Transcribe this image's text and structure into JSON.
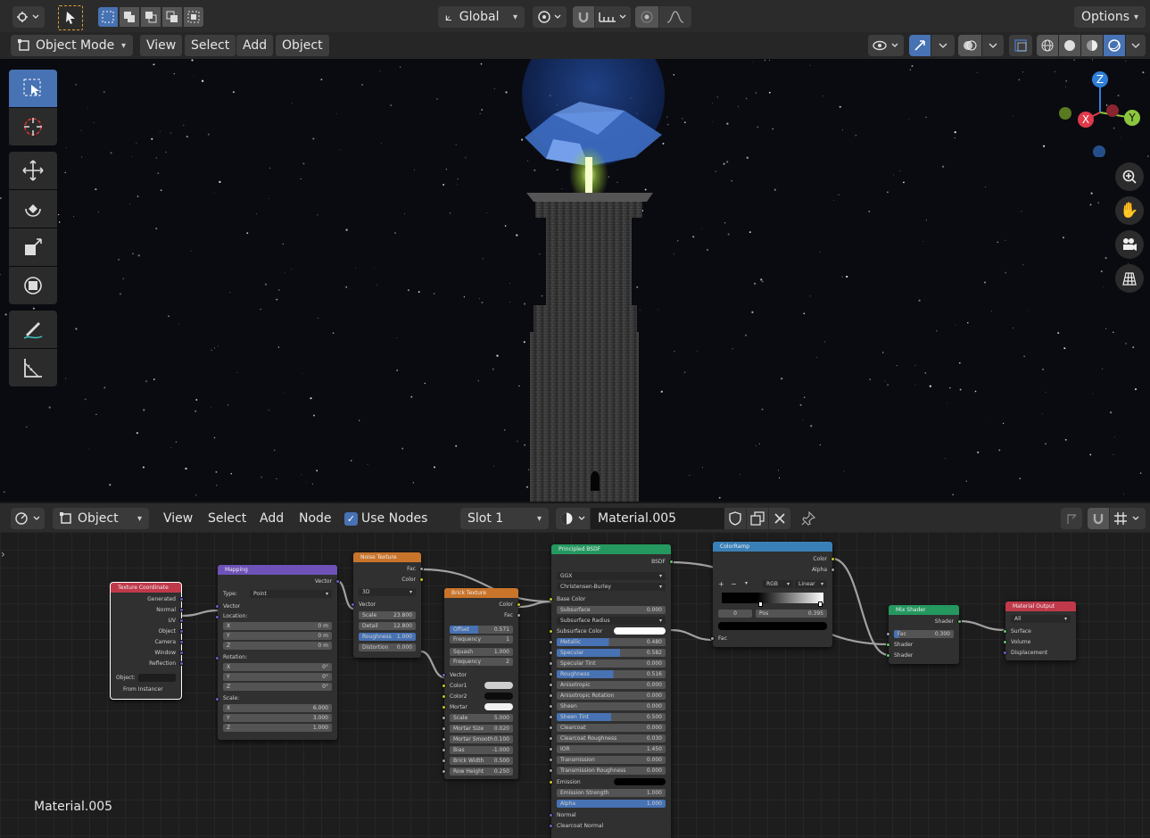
{
  "top_header": {
    "editor_type_icon": "editor-type-icon",
    "select_mode_icons": [
      "select-box-icon",
      "select-extend-icon",
      "select-subtract-icon",
      "select-invert-icon",
      "select-intersect-icon"
    ],
    "transform_orientation": "Global",
    "options_label": "Options"
  },
  "viewport_header": {
    "mode": "Object Mode",
    "menus": [
      "View",
      "Select",
      "Add",
      "Object"
    ]
  },
  "toolbar": {
    "tools": [
      "select-box-icon",
      "cursor-icon",
      "move-icon",
      "rotate-icon",
      "scale-icon",
      "transform-icon",
      "annotate-icon",
      "measure-icon"
    ]
  },
  "gizmo": {
    "x": "X",
    "y": "Y",
    "z": "Z"
  },
  "node_header": {
    "object_dropdown": "Object",
    "menus": [
      "View",
      "Select",
      "Add",
      "Node"
    ],
    "use_nodes_label": "Use Nodes",
    "use_nodes": true,
    "slot": "Slot 1",
    "material_name": "Material.005"
  },
  "material_footer_label": "Material.005",
  "nodes": {
    "texcoord": {
      "title": "Texture Coordinate",
      "outputs": [
        "Generated",
        "Normal",
        "UV",
        "Object",
        "Camera",
        "Window",
        "Reflection"
      ],
      "object_label": "Object:",
      "instancer": "From Instancer"
    },
    "mapping": {
      "title": "Mapping",
      "output": "Vector",
      "type_label": "Type:",
      "type": "Point",
      "input": "Vector",
      "location_label": "Location:",
      "loc": [
        [
          "X",
          "0 m"
        ],
        [
          "Y",
          "0 m"
        ],
        [
          "Z",
          "0 m"
        ]
      ],
      "rotation_label": "Rotation:",
      "rot": [
        [
          "X",
          "0°"
        ],
        [
          "Y",
          "0°"
        ],
        [
          "Z",
          "0°"
        ]
      ],
      "scale_label": "Scale:",
      "scale": [
        [
          "X",
          "6.000"
        ],
        [
          "Y",
          "3.000"
        ],
        [
          "Z",
          "1.000"
        ]
      ]
    },
    "noise": {
      "title": "Noise Texture",
      "outputs": [
        "Fac",
        "Color"
      ],
      "dim": "3D",
      "input": "Vector",
      "fields": [
        [
          "Scale",
          "23.800"
        ],
        [
          "Detail",
          "12.800"
        ],
        [
          "Roughness",
          "1.000"
        ],
        [
          "Distortion",
          "0.000"
        ]
      ]
    },
    "brick": {
      "title": "Brick Texture",
      "outputs": [
        "Color",
        "Fac"
      ],
      "fields1": [
        [
          "Offset",
          "0.571"
        ],
        [
          "Frequency",
          "1"
        ],
        [
          "Squash",
          "1.000"
        ],
        [
          "Frequency",
          "2"
        ]
      ],
      "inputs": [
        "Vector",
        "Color1",
        "Color2",
        "Mortar"
      ],
      "fields2": [
        [
          "Scale",
          "5.000"
        ],
        [
          "Mortar Size",
          "0.020"
        ],
        [
          "Mortar Smooth",
          "0.100"
        ],
        [
          "Bias",
          "-1.000"
        ],
        [
          "Brick Width",
          "0.500"
        ],
        [
          "Row Height",
          "0.250"
        ]
      ]
    },
    "bsdf": {
      "title": "Principled BSDF",
      "output": "BSDF",
      "distribution": "GGX",
      "subsurface_method": "Christensen-Burley",
      "base_color": "Base Color",
      "subsurface": [
        "Subsurface",
        "0.000"
      ],
      "subsurface_radius": "Subsurface Radius",
      "subsurface_color": "Subsurface Color",
      "fields": [
        [
          "Metallic",
          "0.480"
        ],
        [
          "Specular",
          "0.582"
        ],
        [
          "Specular Tint",
          "0.000"
        ],
        [
          "Roughness",
          "0.516"
        ],
        [
          "Anisotropic",
          "0.000"
        ],
        [
          "Anisotropic Rotation",
          "0.000"
        ],
        [
          "Sheen",
          "0.000"
        ],
        [
          "Sheen Tint",
          "0.500"
        ],
        [
          "Clearcoat",
          "0.000"
        ],
        [
          "Clearcoat Roughness",
          "0.030"
        ],
        [
          "IOR",
          "1.450"
        ],
        [
          "Transmission",
          "0.000"
        ],
        [
          "Transmission Roughness",
          "0.000"
        ]
      ],
      "emission": "Emission",
      "emission_strength": [
        "Emission Strength",
        "1.000"
      ],
      "alpha": [
        "Alpha",
        "1.000"
      ],
      "normal": "Normal",
      "clearcoat_normal": "Clearcoat Normal"
    },
    "ramp": {
      "title": "ColorRamp",
      "outputs": [
        "Color",
        "Alpha"
      ],
      "mode": "RGB",
      "interp": "Linear",
      "stop_index": "0",
      "pos_label": "Pos",
      "pos": "0.395",
      "input": "Fac"
    },
    "mix": {
      "title": "Mix Shader",
      "output": "Shader",
      "fac": [
        "Fac",
        "0.300"
      ],
      "inputs": [
        "Shader",
        "Shader"
      ]
    },
    "out": {
      "title": "Material Output",
      "target": "All",
      "inputs": [
        "Surface",
        "Volume",
        "Displacement"
      ]
    }
  },
  "colors": {
    "header_bg": "#303030",
    "accent": "#4772b3",
    "shader_socket": "#63c763",
    "color_socket": "#c7c729",
    "vector_socket": "#6363c7",
    "float_socket": "#a1a1a1"
  }
}
